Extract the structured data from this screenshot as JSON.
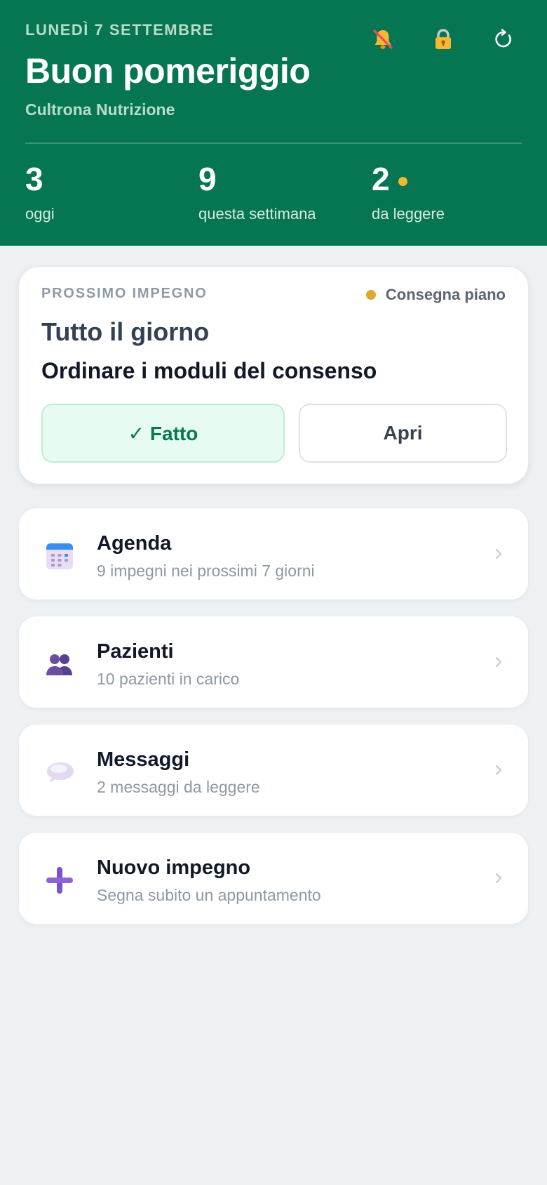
{
  "header": {
    "date": "LUNEDÌ 7 SETTEMBRE",
    "greeting": "Buon pomeriggio",
    "studio": "Cultrona Nutrizione",
    "icons": [
      "bell-muted-icon",
      "lock-icon",
      "refresh-icon"
    ],
    "stats": [
      {
        "value": "3",
        "label": "oggi"
      },
      {
        "value": "9",
        "label": "questa settimana"
      },
      {
        "value": "2",
        "label": "da leggere"
      }
    ]
  },
  "next": {
    "label": "PROSSIMO IMPEGNO",
    "tag": "Consegna piano",
    "time": "Tutto il giorno",
    "title": "Ordinare i moduli del consenso",
    "done_label": "✓ Fatto",
    "open_label": "Apri"
  },
  "menu": [
    {
      "icon": "calendar-icon",
      "title": "Agenda",
      "subtitle": "9 impegni nei prossimi 7 giorni"
    },
    {
      "icon": "people-icon",
      "title": "Pazienti",
      "subtitle": "10 pazienti in carico"
    },
    {
      "icon": "speech-bubble-icon",
      "title": "Messaggi",
      "subtitle": "2 messaggi da leggere"
    },
    {
      "icon": "plus-icon",
      "title": "Nuovo impegno",
      "subtitle": "Segna subito un appuntamento"
    }
  ],
  "colors": {
    "brand": "#057651",
    "accent_dot": "#f5b731",
    "tag_dot": "#e0a82e",
    "done_text": "#067a52"
  }
}
